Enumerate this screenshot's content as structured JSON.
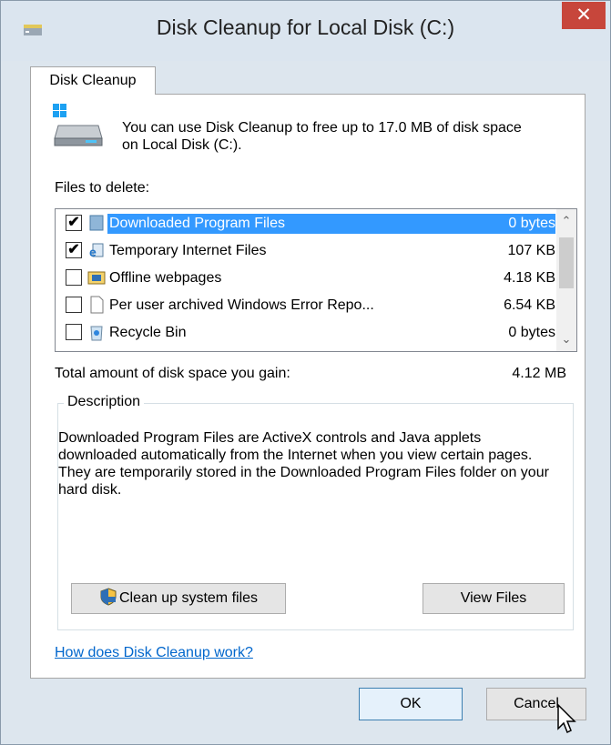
{
  "window": {
    "title": "Disk Cleanup for Local Disk (C:)",
    "close_glyph": "✕"
  },
  "tab": {
    "label": "Disk Cleanup"
  },
  "intro": {
    "text": "You can use Disk Cleanup to free up to 17.0 MB of disk space on Local Disk (C:)."
  },
  "files": {
    "label": "Files to delete:",
    "items": [
      {
        "name": "Downloaded Program Files",
        "size": "0 bytes",
        "checked": true,
        "selected": true,
        "icon": "folder-icon"
      },
      {
        "name": "Temporary Internet Files",
        "size": "107 KB",
        "checked": true,
        "selected": false,
        "icon": "internet-files-icon"
      },
      {
        "name": "Offline webpages",
        "size": "4.18 KB",
        "checked": false,
        "selected": false,
        "icon": "offline-webpages-icon"
      },
      {
        "name": "Per user archived Windows Error Repo...",
        "size": "6.54 KB",
        "checked": false,
        "selected": false,
        "icon": "document-icon"
      },
      {
        "name": "Recycle Bin",
        "size": "0 bytes",
        "checked": false,
        "selected": false,
        "icon": "recycle-bin-icon"
      }
    ]
  },
  "total": {
    "label": "Total amount of disk space you gain:",
    "value": "4.12 MB"
  },
  "description": {
    "legend": "Description",
    "text": "Downloaded Program Files are ActiveX controls and Java applets downloaded automatically from the Internet when you view certain pages. They are temporarily stored in the Downloaded Program Files folder on your hard disk."
  },
  "buttons": {
    "cleanup_system": "Clean up system files",
    "view_files": "View Files",
    "ok": "OK",
    "cancel": "Cancel"
  },
  "help_link": "How does Disk Cleanup work?",
  "colors": {
    "selection": "#3399ff",
    "close": "#c7463b",
    "link": "#0066cc"
  }
}
